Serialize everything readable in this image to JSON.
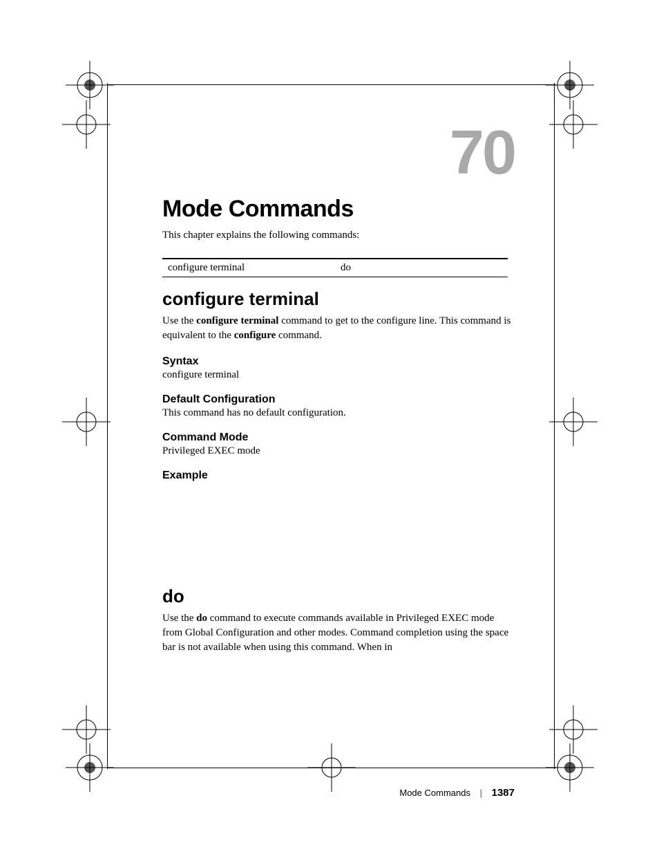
{
  "chapter": {
    "number": "70",
    "title": "Mode Commands",
    "intro": "This chapter explains the following commands:"
  },
  "command_table": {
    "col1": "configure terminal",
    "col2": "do"
  },
  "sections": [
    {
      "id": "configure-terminal",
      "title": "configure terminal",
      "desc_pre": "Use the ",
      "desc_bold1": "configure terminal",
      "desc_mid": " command to get to the configure line. This command is equivalent to the ",
      "desc_bold2": "configure",
      "desc_post": " command.",
      "subs": [
        {
          "head": "Syntax",
          "text": "configure terminal"
        },
        {
          "head": "Default Configuration",
          "text": "This command has no default configuration."
        },
        {
          "head": "Command Mode",
          "text": "Privileged EXEC mode"
        },
        {
          "head": "Example",
          "text": ""
        }
      ]
    },
    {
      "id": "do",
      "title": "do",
      "desc_pre": "Use the ",
      "desc_bold1": "do",
      "desc_mid": " command to execute commands available in Privileged EXEC mode from Global Configuration and other modes. Command completion using the space bar is not available when using this command. When in",
      "desc_bold2": "",
      "desc_post": ""
    }
  ],
  "footer": {
    "label": "Mode Commands",
    "page": "1387"
  }
}
